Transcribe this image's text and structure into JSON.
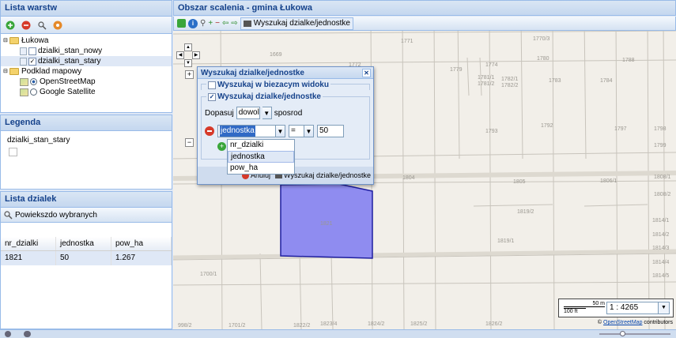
{
  "layers_panel": {
    "title": "Lista warstw",
    "tree": [
      {
        "label": "Łukowa",
        "level": 0,
        "type": "folder"
      },
      {
        "label": "dzialki_stan_nowy",
        "level": 1,
        "type": "layer",
        "checked": false
      },
      {
        "label": "dzialki_stan_stary",
        "level": 1,
        "type": "layer",
        "checked": true
      },
      {
        "label": "Podklad mapowy",
        "level": 0,
        "type": "folder"
      },
      {
        "label": "OpenStreetMap",
        "level": 1,
        "type": "base",
        "checked": true
      },
      {
        "label": "Google Satellite",
        "level": 1,
        "type": "base",
        "checked": false
      }
    ]
  },
  "legend_panel": {
    "title": "Legenda",
    "layer_name": "dzialki_stan_stary"
  },
  "parcels_panel": {
    "title": "Lista dzialek",
    "zoom_button": "Powiekszdo wybranych",
    "columns": [
      "nr_dzialki",
      "jednostka",
      "pow_ha"
    ],
    "rows": [
      [
        "1821",
        "50",
        "1.267"
      ]
    ]
  },
  "map_panel": {
    "title": "Obszar scalenia - gmina Łukowa",
    "search_button": "Wyszukaj dzialke/jednostke",
    "scale_value": "1 : 4265",
    "scale_bar_m": "50 m",
    "scale_bar_ft": "100 ft",
    "attribution_link": "OpenStreetMap",
    "attribution_text": "contributors",
    "copyright": "©",
    "parcel_labels": [
      {
        "label": "1771"
      },
      {
        "label": "1770/3"
      },
      {
        "label": "1669"
      },
      {
        "label": "1772"
      },
      {
        "label": "1774"
      },
      {
        "label": "1780"
      },
      {
        "label": "1788"
      },
      {
        "label": "1775"
      },
      {
        "label": "1776"
      },
      {
        "label": "1777"
      },
      {
        "label": "1778"
      },
      {
        "label": "1779"
      },
      {
        "label": "1781/1"
      },
      {
        "label": "1781/2"
      },
      {
        "label": "1782/1"
      },
      {
        "label": "1782/2"
      },
      {
        "label": "1783"
      },
      {
        "label": "1784"
      },
      {
        "label": "1793"
      },
      {
        "label": "1792"
      },
      {
        "label": "1797"
      },
      {
        "label": "1798"
      },
      {
        "label": "1799"
      },
      {
        "label": "1804"
      },
      {
        "label": "1805"
      },
      {
        "label": "1806/1"
      },
      {
        "label": "1808/1"
      },
      {
        "label": "1808/2"
      },
      {
        "label": "1821"
      },
      {
        "label": "1819/2"
      },
      {
        "label": "1819/1"
      },
      {
        "label": "1814/1"
      },
      {
        "label": "1814/2"
      },
      {
        "label": "1814/3"
      },
      {
        "label": "1814/4"
      },
      {
        "label": "1814/5"
      },
      {
        "label": "1700/1"
      },
      {
        "label": "1701/2"
      },
      {
        "label": "1822/2"
      },
      {
        "label": "1823/4"
      },
      {
        "label": "1824/2"
      },
      {
        "label": "1825/2"
      },
      {
        "label": "1826/2"
      },
      {
        "label": "998/2"
      }
    ]
  },
  "search_window": {
    "title": "Wyszukaj dzialke/jednostke",
    "option_view": "Wyszukaj w biezacym widoku",
    "option_search": "Wyszukaj dzialke/jednostke",
    "match_label": "Dopasuj",
    "match_value": "dowolne",
    "match_suffix": "sposrod",
    "field_value": "jednostka",
    "operator_value": "=",
    "input_value": "50",
    "field_options": [
      "nr_dzialki",
      "jednostka",
      "pow_ha"
    ],
    "cancel_button": "Anuluj",
    "search_button": "Wyszukaj dzialke/jednostke",
    "add_hint": "d"
  }
}
